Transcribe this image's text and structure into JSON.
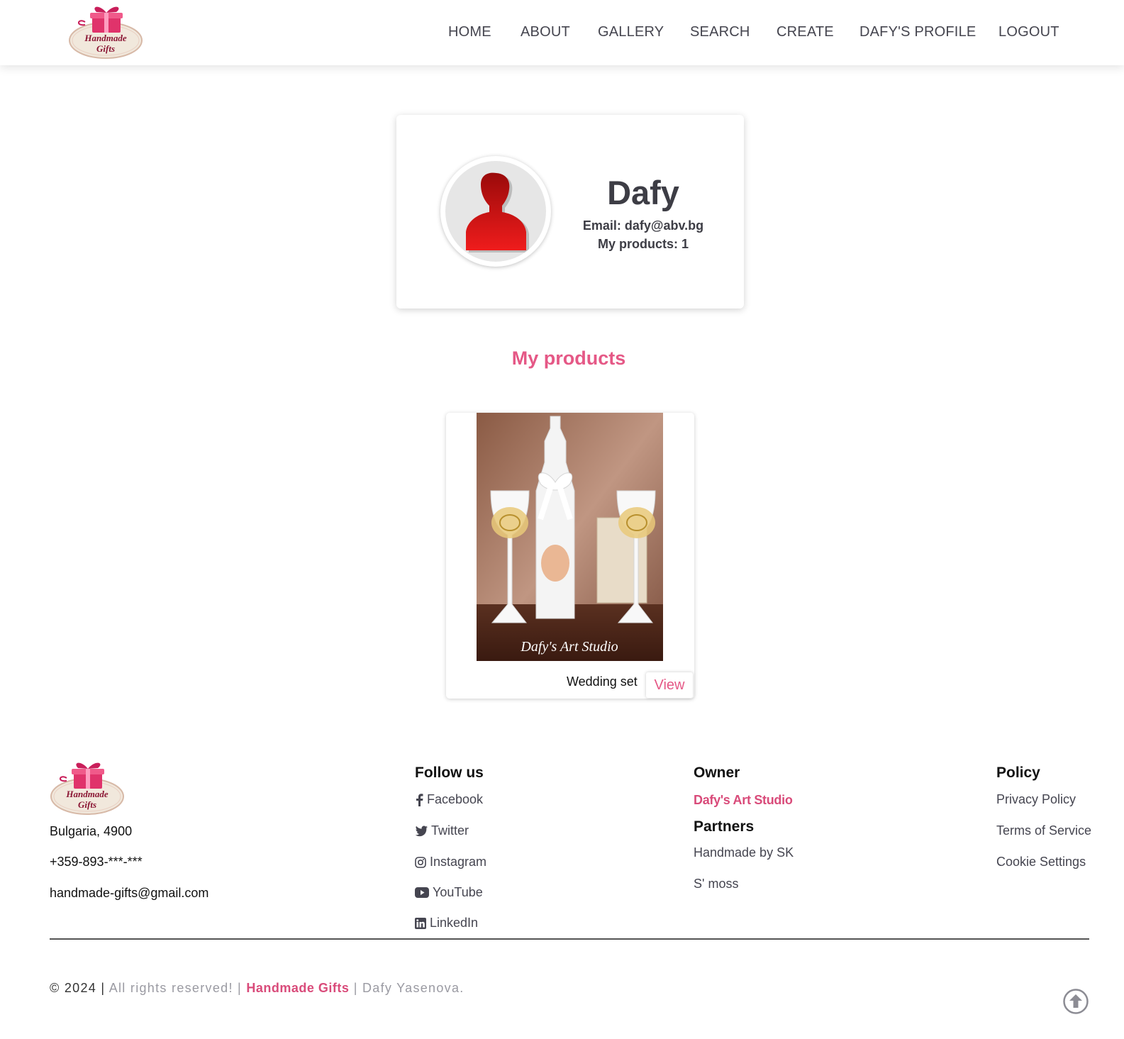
{
  "brand": {
    "logo_line1": "Handmade",
    "logo_line2": "Gifts",
    "ribbon_color": "#e0336b",
    "badge_color": "#f1e8dc",
    "text_color": "#8a1533"
  },
  "nav": {
    "items": [
      {
        "label": "HOME"
      },
      {
        "label": "ABOUT"
      },
      {
        "label": "GALLERY"
      },
      {
        "label": "SEARCH"
      },
      {
        "label": "CREATE"
      },
      {
        "label": "DAFY'S PROFILE"
      },
      {
        "label": "LOGOUT"
      }
    ]
  },
  "profile": {
    "name": "Dafy",
    "email_text": "Email: dafy@abv.bg",
    "products_text": "My products: 1",
    "avatar_icon": "user-silhouette-icon",
    "avatar_color": "#d41414"
  },
  "products_section": {
    "title": "My products",
    "items": [
      {
        "name": "Wedding set",
        "button_label": "View",
        "image_watermark": "Dafy's Art Studio"
      }
    ]
  },
  "footer": {
    "address": "Bulgaria, 4900",
    "phone": "+359-893-***-***",
    "email": "handmade-gifts@gmail.com",
    "follow": {
      "heading": "Follow us",
      "links": [
        {
          "label": "Facebook",
          "icon": "facebook-icon"
        },
        {
          "label": "Twitter",
          "icon": "twitter-icon"
        },
        {
          "label": "Instagram",
          "icon": "instagram-icon"
        },
        {
          "label": "YouTube",
          "icon": "youtube-icon"
        },
        {
          "label": "LinkedIn",
          "icon": "linkedin-icon"
        }
      ]
    },
    "owner": {
      "heading": "Owner",
      "name": "Dafy's Art Studio"
    },
    "partners": {
      "heading": "Partners",
      "links": [
        "Handmade by SK",
        "S' moss"
      ]
    },
    "policy": {
      "heading": "Policy",
      "links": [
        "Privacy Policy",
        "Terms of Service",
        "Cookie Settings"
      ]
    },
    "copyright": {
      "prefix": "© 2024 |",
      "middle": "All rights reserved! |",
      "brand": "Handmade Gifts",
      "suffix": "| Dafy Yasenova."
    },
    "back_to_top_icon": "arrow-up-circle-icon"
  },
  "colors": {
    "accent": "#e55886",
    "nav_text": "#45454f"
  }
}
